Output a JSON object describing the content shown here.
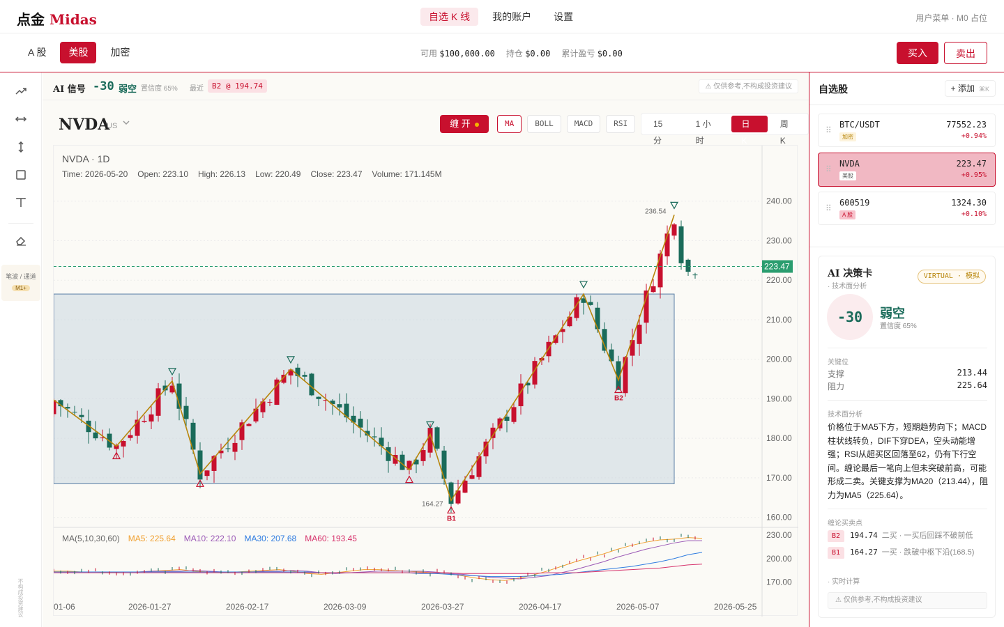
{
  "app": {
    "logo_cn": "点金",
    "logo_en": "Midas"
  },
  "nav": {
    "items": [
      {
        "label": "自选 K 线",
        "active": true
      },
      {
        "label": "我的账户",
        "active": false
      },
      {
        "label": "设置",
        "active": false
      }
    ]
  },
  "user_menu": "用户菜单 · M0 占位",
  "market_tabs": [
    {
      "label": "A 股",
      "active": false
    },
    {
      "label": "美股",
      "active": true
    },
    {
      "label": "加密",
      "active": false
    }
  ],
  "account": {
    "available_label": "可用",
    "available": "$100,000.00",
    "position_label": "持仓",
    "position": "$0.00",
    "pnl_label": "累计盈亏",
    "pnl": "$0.00"
  },
  "trade": {
    "buy": "买入",
    "sell": "卖出"
  },
  "toolbar": {
    "wave_label": "笔波 / 通道",
    "wave_badge": "M1+",
    "disclaimer": "不构成投资建议"
  },
  "signal": {
    "title": "AI 信号",
    "score": "-30",
    "label": "弱空",
    "confidence": "置信度 65%",
    "latest_label": "最近",
    "latest": "B2 @ 194.74",
    "disclaimer": "仅供参考,不构成投资建议"
  },
  "symbol": {
    "ticker": "NVDA",
    "market": "US"
  },
  "chan_button": "缠 开",
  "indicators": [
    {
      "label": "MA",
      "active": true
    },
    {
      "label": "BOLL",
      "active": false
    },
    {
      "label": "MACD",
      "active": false
    },
    {
      "label": "RSI",
      "active": false
    }
  ],
  "timeframes": [
    {
      "label": "15 分",
      "active": false
    },
    {
      "label": "1 小时",
      "active": false
    },
    {
      "label": "日 K",
      "active": true
    },
    {
      "label": "周 K",
      "active": false
    }
  ],
  "ohlc": {
    "title": "NVDA · 1D",
    "time": "Time: 2026-05-20",
    "open": "Open: 223.10",
    "high": "High: 226.13",
    "low": "Low: 220.49",
    "close": "Close: 223.47",
    "volume": "Volume: 171.145M"
  },
  "ma_legend": {
    "title": "MA(5,10,30,60)",
    "ma5": "MA5: 225.64",
    "ma10": "MA10: 222.10",
    "ma30": "MA30: 207.68",
    "ma60": "MA60: 193.45"
  },
  "colors": {
    "up": "#c8102e",
    "down": "#1a6b5a",
    "accent": "#c8102e",
    "stroke": "#b8860b",
    "ma5": "#f0a030",
    "ma10": "#9b59b6",
    "ma30": "#2f7ce0",
    "ma60": "#d6336c"
  },
  "chart_data": {
    "type": "candlestick",
    "price_ticks": [
      "240.00",
      "230.00",
      "220.00",
      "210.00",
      "200.00",
      "190.00",
      "180.00",
      "170.00",
      "160.00"
    ],
    "ylim": [
      158,
      247
    ],
    "ma_ticks": [
      "230.00",
      "200.00",
      "170.00"
    ],
    "ma_ylim": [
      158,
      240
    ],
    "x_ticks": [
      "01-06",
      "2026-01-27",
      "2026-02-17",
      "2026-03-09",
      "2026-03-27",
      "2026-04-17",
      "2026-05-07",
      "2026-05-25"
    ],
    "last_price": "223.47",
    "labels": {
      "high": "236.54",
      "low": "164.27",
      "b1": "B1",
      "b2": "B2"
    },
    "pivots": [
      {
        "i": -1,
        "p": 191
      },
      {
        "i": 9,
        "p": 178
      },
      {
        "i": 17,
        "p": 194.5
      },
      {
        "i": 21,
        "p": 171
      },
      {
        "i": 34,
        "p": 197.5
      },
      {
        "i": 51,
        "p": 172
      },
      {
        "i": 54,
        "p": 181
      },
      {
        "i": 57,
        "p": 164.27
      },
      {
        "i": 76,
        "p": 216.5
      },
      {
        "i": 81,
        "p": 194.74
      },
      {
        "i": 89,
        "p": 236.54
      }
    ],
    "zone": {
      "from": -2,
      "to": 89,
      "low": 168.5,
      "high": 216.5
    },
    "markers": [
      {
        "i": 9,
        "type": "buy"
      },
      {
        "i": 17,
        "type": "sell"
      },
      {
        "i": 21,
        "type": "buy"
      },
      {
        "i": 34,
        "type": "sell"
      },
      {
        "i": 51,
        "type": "buy"
      },
      {
        "i": 54,
        "type": "sell"
      },
      {
        "i": 57,
        "type": "buy",
        "label": "B1"
      },
      {
        "i": 76,
        "type": "sell"
      },
      {
        "i": 81,
        "type": "buy",
        "label": "B2"
      },
      {
        "i": 89,
        "type": "sell"
      }
    ],
    "ma": [
      {
        "name": "MA5",
        "values": [
          184,
          184,
          183,
          183,
          182,
          183,
          183,
          184,
          185,
          186,
          184,
          183,
          182,
          183,
          184,
          185,
          186,
          184,
          181,
          180,
          182,
          184,
          186,
          186,
          185,
          184,
          183,
          182,
          181,
          178,
          175,
          173,
          172,
          175,
          179,
          184,
          190,
          196,
          201,
          206,
          212,
          217,
          221,
          224,
          225,
          227,
          226
        ]
      },
      {
        "name": "MA10",
        "values": [
          183,
          183,
          183,
          183,
          183,
          183,
          183,
          184,
          184,
          184,
          185,
          184,
          183,
          183,
          183,
          184,
          184,
          185,
          184,
          182,
          181,
          182,
          183,
          184,
          184,
          184,
          184,
          183,
          181,
          180,
          178,
          176,
          175,
          174,
          176,
          178,
          182,
          186,
          191,
          196,
          202,
          207,
          212,
          216,
          220,
          223,
          223
        ]
      },
      {
        "name": "MA30",
        "values": [
          183,
          183,
          183,
          183,
          183,
          183,
          183,
          183,
          183,
          183,
          183,
          183,
          183,
          183,
          183,
          183,
          183,
          183,
          183,
          182,
          182,
          182,
          182,
          182,
          182,
          182,
          181,
          181,
          180,
          179,
          178,
          177,
          177,
          177,
          178,
          179,
          180,
          182,
          184,
          186,
          188,
          190,
          193,
          196,
          200,
          205,
          208
        ]
      },
      {
        "name": "MA60",
        "values": [
          182,
          182,
          182,
          182,
          182,
          182,
          182,
          182,
          182,
          182,
          182,
          182,
          182,
          182,
          182,
          182,
          182,
          182,
          182,
          182,
          182,
          182,
          182,
          182,
          182,
          182,
          182,
          182,
          182,
          181,
          181,
          181,
          181,
          181,
          181,
          182,
          182,
          182,
          183,
          184,
          185,
          186,
          187,
          188,
          190,
          192,
          193
        ]
      }
    ]
  },
  "watchlist": {
    "title": "自选股",
    "add": "添加",
    "shortcut": "⌘K",
    "items": [
      {
        "symbol": "BTC/USDT",
        "tag": "加密",
        "price": "77552.23",
        "change": "+0.94%",
        "selected": false
      },
      {
        "symbol": "NVDA",
        "tag": "美股",
        "price": "223.47",
        "change": "+0.95%",
        "selected": true
      },
      {
        "symbol": "600519",
        "tag": "A 股",
        "price": "1324.30",
        "change": "+0.10%",
        "selected": false
      }
    ]
  },
  "decision": {
    "title": "AI 决策卡",
    "subtitle": "· 技术面分析",
    "badge": "VIRTUAL · 模拟",
    "score": "-30",
    "label": "弱空",
    "confidence": "置信度 65%",
    "key_title": "关键位",
    "support_label": "支撑",
    "support": "213.44",
    "resistance_label": "阻力",
    "resistance": "225.64",
    "analysis_title": "技术面分析",
    "analysis": "价格位于MA5下方，短期趋势向下；MACD柱状线转负，DIF下穿DEA，空头动能增强；RSI从超买区回落至62，仍有下行空间。缠论最后一笔向上但未突破前高，可能形成二卖。关键支撑为MA20（213.44），阻力为MA5（225.64）。",
    "bs_title": "缠论买卖点",
    "bs_points": [
      {
        "tag": "B2",
        "price": "194.74",
        "text": "二买 · 一买后回踩不破前低"
      },
      {
        "tag": "B1",
        "price": "164.27",
        "text": "一买 · 跌破中枢下沿(168.5)"
      }
    ],
    "realtime": "· 实时计算",
    "disclaimer": "仅供参考,不构成投资建议"
  }
}
